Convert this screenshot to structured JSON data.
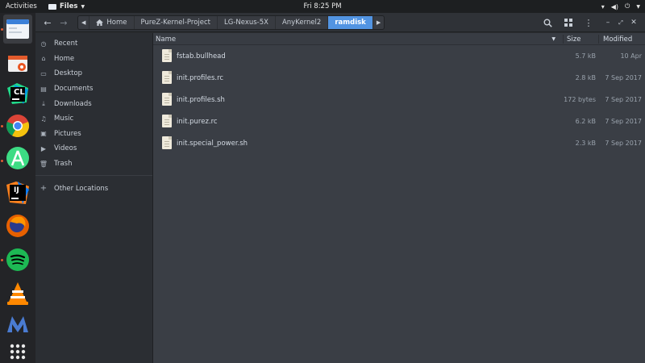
{
  "topbar": {
    "activities": "Activities",
    "app_name": "Files",
    "clock": "Fri  8:25 PM"
  },
  "dock": {
    "items": [
      "files",
      "ubuntu-software",
      "clion",
      "chrome",
      "android-studio",
      "intellij",
      "firefox",
      "spotify",
      "vlc",
      "multipass",
      "show-applications"
    ],
    "clion_label": "CL",
    "intellij_label": "IJ"
  },
  "pathbar": {
    "segments": [
      "Home",
      "PureZ-Kernel-Project",
      "LG-Nexus-5X",
      "AnyKernel2",
      "ramdisk"
    ]
  },
  "sidebar": {
    "items": [
      {
        "label": "Recent",
        "icon": "clock-icon"
      },
      {
        "label": "Home",
        "icon": "home-icon"
      },
      {
        "label": "Desktop",
        "icon": "folder-icon"
      },
      {
        "label": "Documents",
        "icon": "folder-icon"
      },
      {
        "label": "Downloads",
        "icon": "download-icon"
      },
      {
        "label": "Music",
        "icon": "music-icon"
      },
      {
        "label": "Pictures",
        "icon": "picture-icon"
      },
      {
        "label": "Videos",
        "icon": "video-icon"
      },
      {
        "label": "Trash",
        "icon": "trash-icon"
      }
    ],
    "other_locations": "Other Locations"
  },
  "columns": {
    "name": "Name",
    "size": "Size",
    "modified": "Modified"
  },
  "files": [
    {
      "name": "fstab.bullhead",
      "size": "5.7 kB",
      "modified": "10 Apr"
    },
    {
      "name": "init.profiles.rc",
      "size": "2.8 kB",
      "modified": "7 Sep 2017"
    },
    {
      "name": "init.profiles.sh",
      "size": "172 bytes",
      "modified": "7 Sep 2017"
    },
    {
      "name": "init.purez.rc",
      "size": "6.2 kB",
      "modified": "7 Sep 2017"
    },
    {
      "name": "init.special_power.sh",
      "size": "2.3 kB",
      "modified": "7 Sep 2017"
    }
  ],
  "colors": {
    "accent": "#5294e2",
    "background": "#3a3e45",
    "sidebar": "#2b2e33"
  }
}
